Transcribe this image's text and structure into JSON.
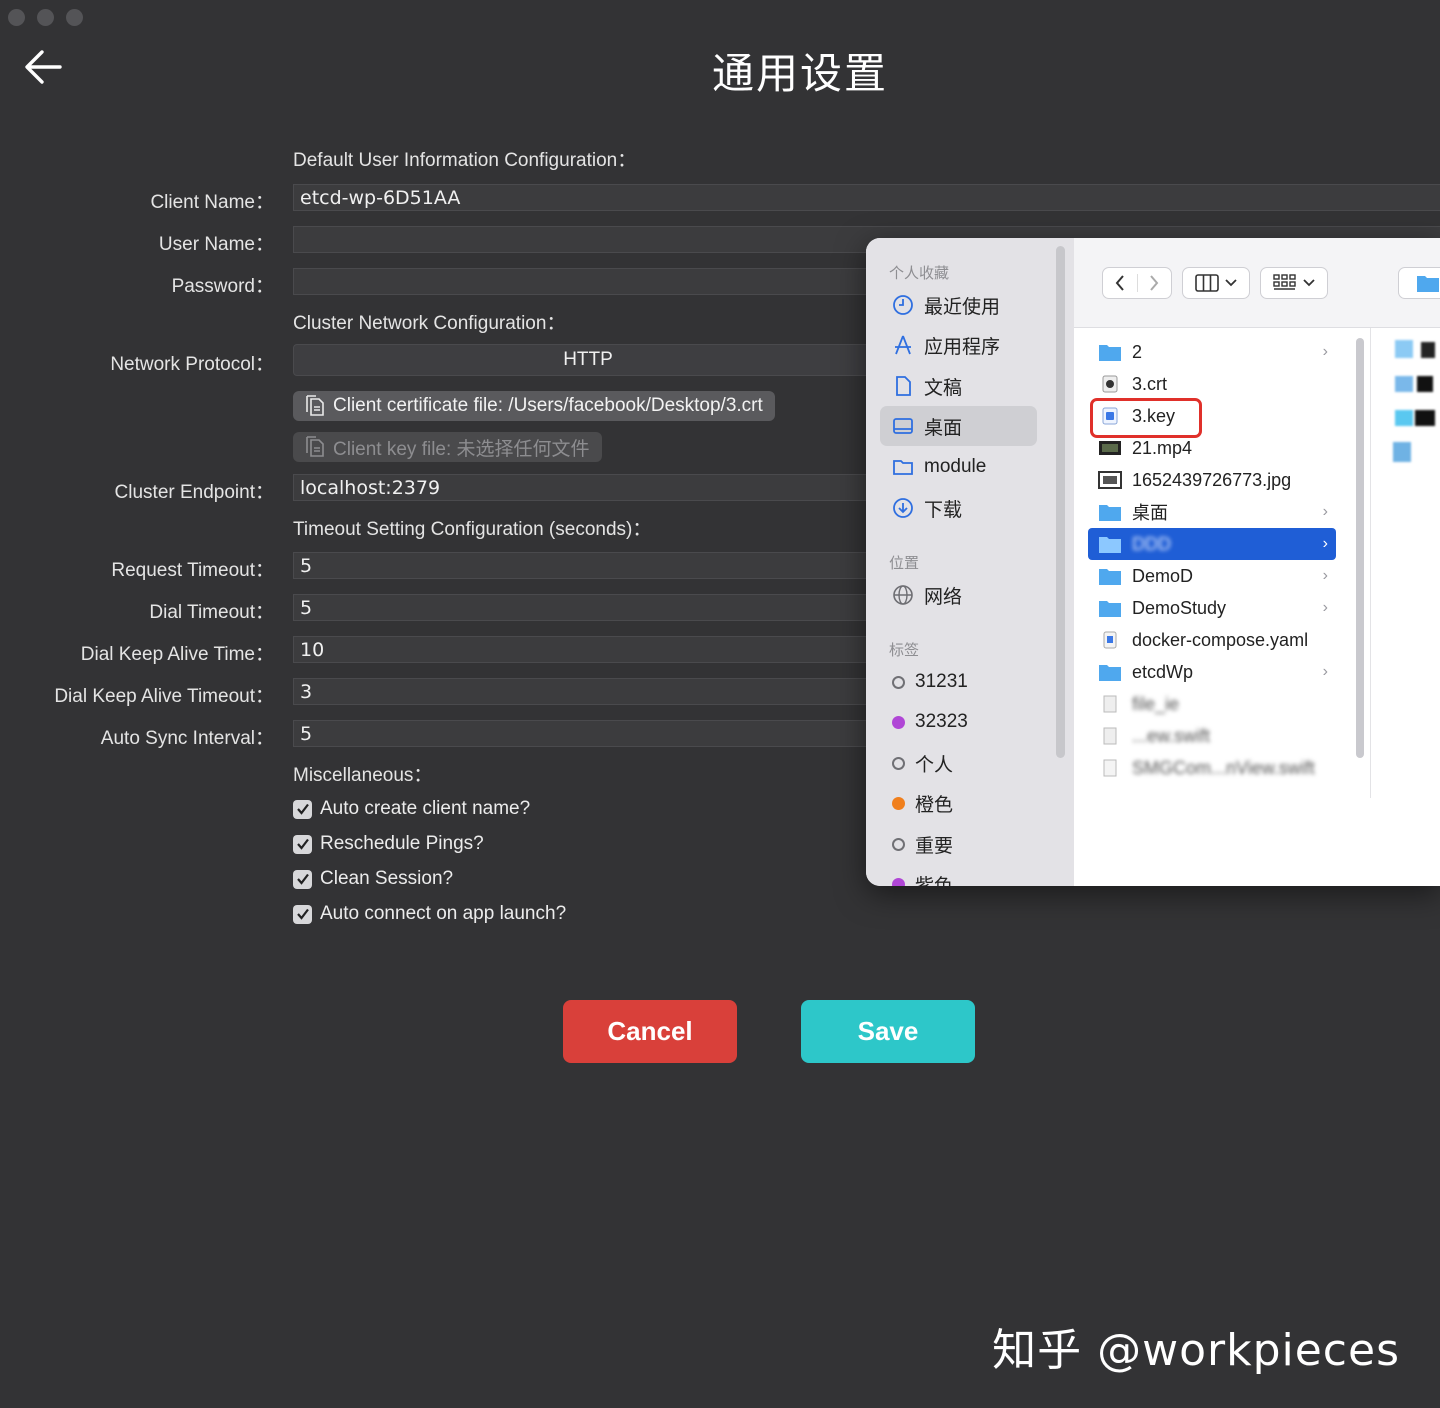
{
  "window": {
    "title": "通用设置"
  },
  "sections": {
    "user_info": "Default User Information Configuration：",
    "cluster_network": "Cluster Network Configuration：",
    "timeout": "Timeout Setting Configuration (seconds)：",
    "misc": "Miscellaneous："
  },
  "fields": {
    "client_name": {
      "label": "Client Name：",
      "value": "etcd-wp-6D51AA"
    },
    "user_name": {
      "label": "User Name：",
      "value": ""
    },
    "password": {
      "label": "Password：",
      "value": ""
    },
    "network_protocol": {
      "label": "Network Protocol：",
      "value": "HTTP"
    },
    "cluster_endpoint": {
      "label": "Cluster Endpoint：",
      "value": "localhost:2379"
    },
    "request_timeout": {
      "label": "Request Timeout：",
      "value": "5"
    },
    "dial_timeout": {
      "label": "Dial Timeout：",
      "value": "5"
    },
    "dial_keep_alive_time": {
      "label": "Dial Keep Alive Time：",
      "value": "10"
    },
    "dial_keep_alive_timeout": {
      "label": "Dial Keep Alive Timeout：",
      "value": "3"
    },
    "auto_sync_interval": {
      "label": "Auto Sync Interval：",
      "value": "5"
    }
  },
  "files": {
    "cert": "Client certificate file: /Users/facebook/Desktop/3.crt",
    "key": "Client key file: 未选择任何文件"
  },
  "checkboxes": [
    {
      "label": "Auto create client name?",
      "checked": true
    },
    {
      "label": "Reschedule Pings?",
      "checked": true
    },
    {
      "label": "Clean Session?",
      "checked": true
    },
    {
      "label": "Auto connect on app launch?",
      "checked": true
    }
  ],
  "buttons": {
    "cancel": "Cancel",
    "save": "Save"
  },
  "finder": {
    "favorites_header": "个人收藏",
    "favorites": [
      "最近使用",
      "应用程序",
      "文稿",
      "桌面",
      "module",
      "下载"
    ],
    "locations_header": "位置",
    "locations": [
      "网络"
    ],
    "tags_header": "标签",
    "tags": [
      {
        "name": "31231",
        "color": ""
      },
      {
        "name": "32323",
        "color": "#b046d6"
      },
      {
        "name": "个人",
        "color": ""
      },
      {
        "name": "橙色",
        "color": "#f07f1d"
      },
      {
        "name": "重要",
        "color": ""
      },
      {
        "name": "紫色",
        "color": "#b046d6"
      }
    ],
    "files": [
      {
        "name": "2",
        "type": "folder",
        "chevron": true
      },
      {
        "name": "3.crt",
        "type": "cert"
      },
      {
        "name": "3.key",
        "type": "key",
        "highlighted": true
      },
      {
        "name": "21.mp4",
        "type": "video"
      },
      {
        "name": "1652439726773.jpg",
        "type": "image"
      },
      {
        "name": "桌面",
        "type": "folder",
        "chevron": true
      },
      {
        "name": "DDD",
        "type": "folder",
        "chevron": true,
        "selected": true
      },
      {
        "name": "DemoD",
        "type": "folder",
        "chevron": true
      },
      {
        "name": "DemoStudy",
        "type": "folder",
        "chevron": true
      },
      {
        "name": "docker-compose.yaml",
        "type": "yaml"
      },
      {
        "name": "etcdWp",
        "type": "folder",
        "chevron": true
      },
      {
        "name": "file_ie",
        "type": "doc",
        "blurred": true
      },
      {
        "name": "...ew.swift",
        "type": "doc",
        "blurred": true
      },
      {
        "name": "SMGCom...nView.swift",
        "type": "doc",
        "blurred": true
      }
    ]
  },
  "watermark": "知乎 @workpieces"
}
